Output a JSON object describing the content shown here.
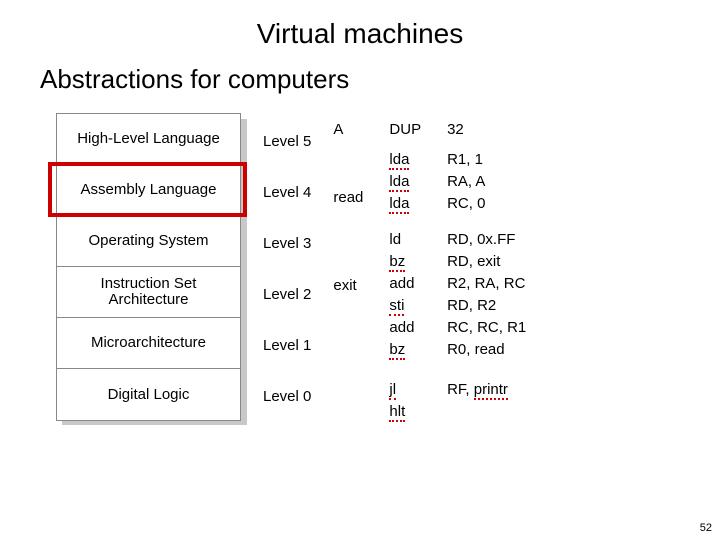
{
  "title": "Virtual machines",
  "subtitle": "Abstractions for computers",
  "layers": [
    "High-Level Language",
    "Assembly Language",
    "Operating System",
    "Instruction Set\nArchitecture",
    "Microarchitecture",
    "Digital Logic"
  ],
  "levels": [
    "Level 5",
    "Level 4",
    "Level 3",
    "Level 2",
    "Level 1",
    "Level 0"
  ],
  "code": {
    "labels": [
      "A",
      "",
      "",
      "",
      "",
      "read",
      "",
      "",
      "",
      "",
      "",
      "",
      "exit"
    ],
    "mnem": [
      "DUP",
      "",
      "lda",
      "lda",
      "lda",
      "",
      "ld",
      "bz",
      "add",
      "sti",
      "add",
      "bz",
      "",
      "jl",
      "hlt"
    ],
    "operands": [
      "32",
      "",
      "R1, 1",
      "RA, A",
      "RC, 0",
      "",
      "RD, 0x.FF",
      "RD, exit",
      "R2, RA, RC",
      "RD, R2",
      "RC, RC, R1",
      "R0, read",
      "",
      "RF, printr"
    ]
  },
  "squiggle": {
    "mnem": [
      false,
      false,
      true,
      true,
      true,
      false,
      false,
      true,
      false,
      true,
      false,
      true,
      false,
      true,
      true
    ],
    "operands": [
      false,
      false,
      false,
      false,
      false,
      false,
      false,
      false,
      false,
      false,
      false,
      false,
      false,
      true
    ]
  },
  "page": "52"
}
